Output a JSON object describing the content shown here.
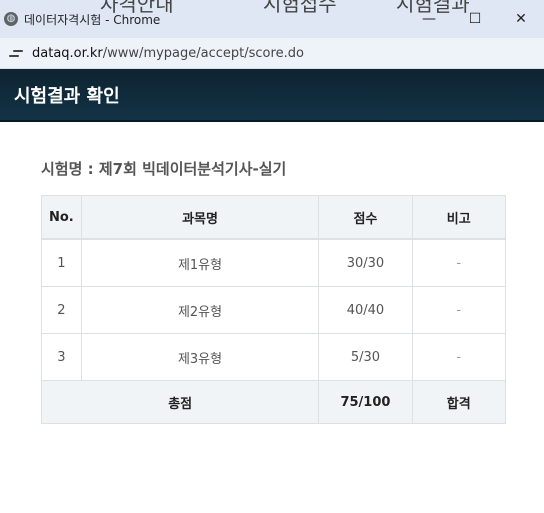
{
  "window": {
    "title": "데이터자격시험 - Chrome",
    "behind_text": [
      "자격안내",
      "시험접수",
      "시험결과"
    ],
    "controls": {
      "minimize": "—",
      "maximize": "☐",
      "close": "✕"
    }
  },
  "address_bar": {
    "host": "dataq.or.kr",
    "path": "/www/mypage/accept/score.do"
  },
  "header": {
    "title": "시험결과 확인"
  },
  "exam": {
    "name": "시험명 : 제7회 빅데이터분석기사-실기"
  },
  "table": {
    "headers": {
      "no": "No.",
      "subject": "과목명",
      "score": "점수",
      "note": "비고"
    },
    "rows": [
      {
        "no": "1",
        "subject": "제1유형",
        "score": "30/30",
        "note": "-"
      },
      {
        "no": "2",
        "subject": "제2유형",
        "score": "40/40",
        "note": "-"
      },
      {
        "no": "3",
        "subject": "제3유형",
        "score": "5/30",
        "note": "-"
      }
    ],
    "total": {
      "label": "총점",
      "score": "75/100",
      "result": "합격"
    }
  },
  "icons": {
    "title": "chrome-globe-icon",
    "site_info": "site-settings-icon"
  }
}
